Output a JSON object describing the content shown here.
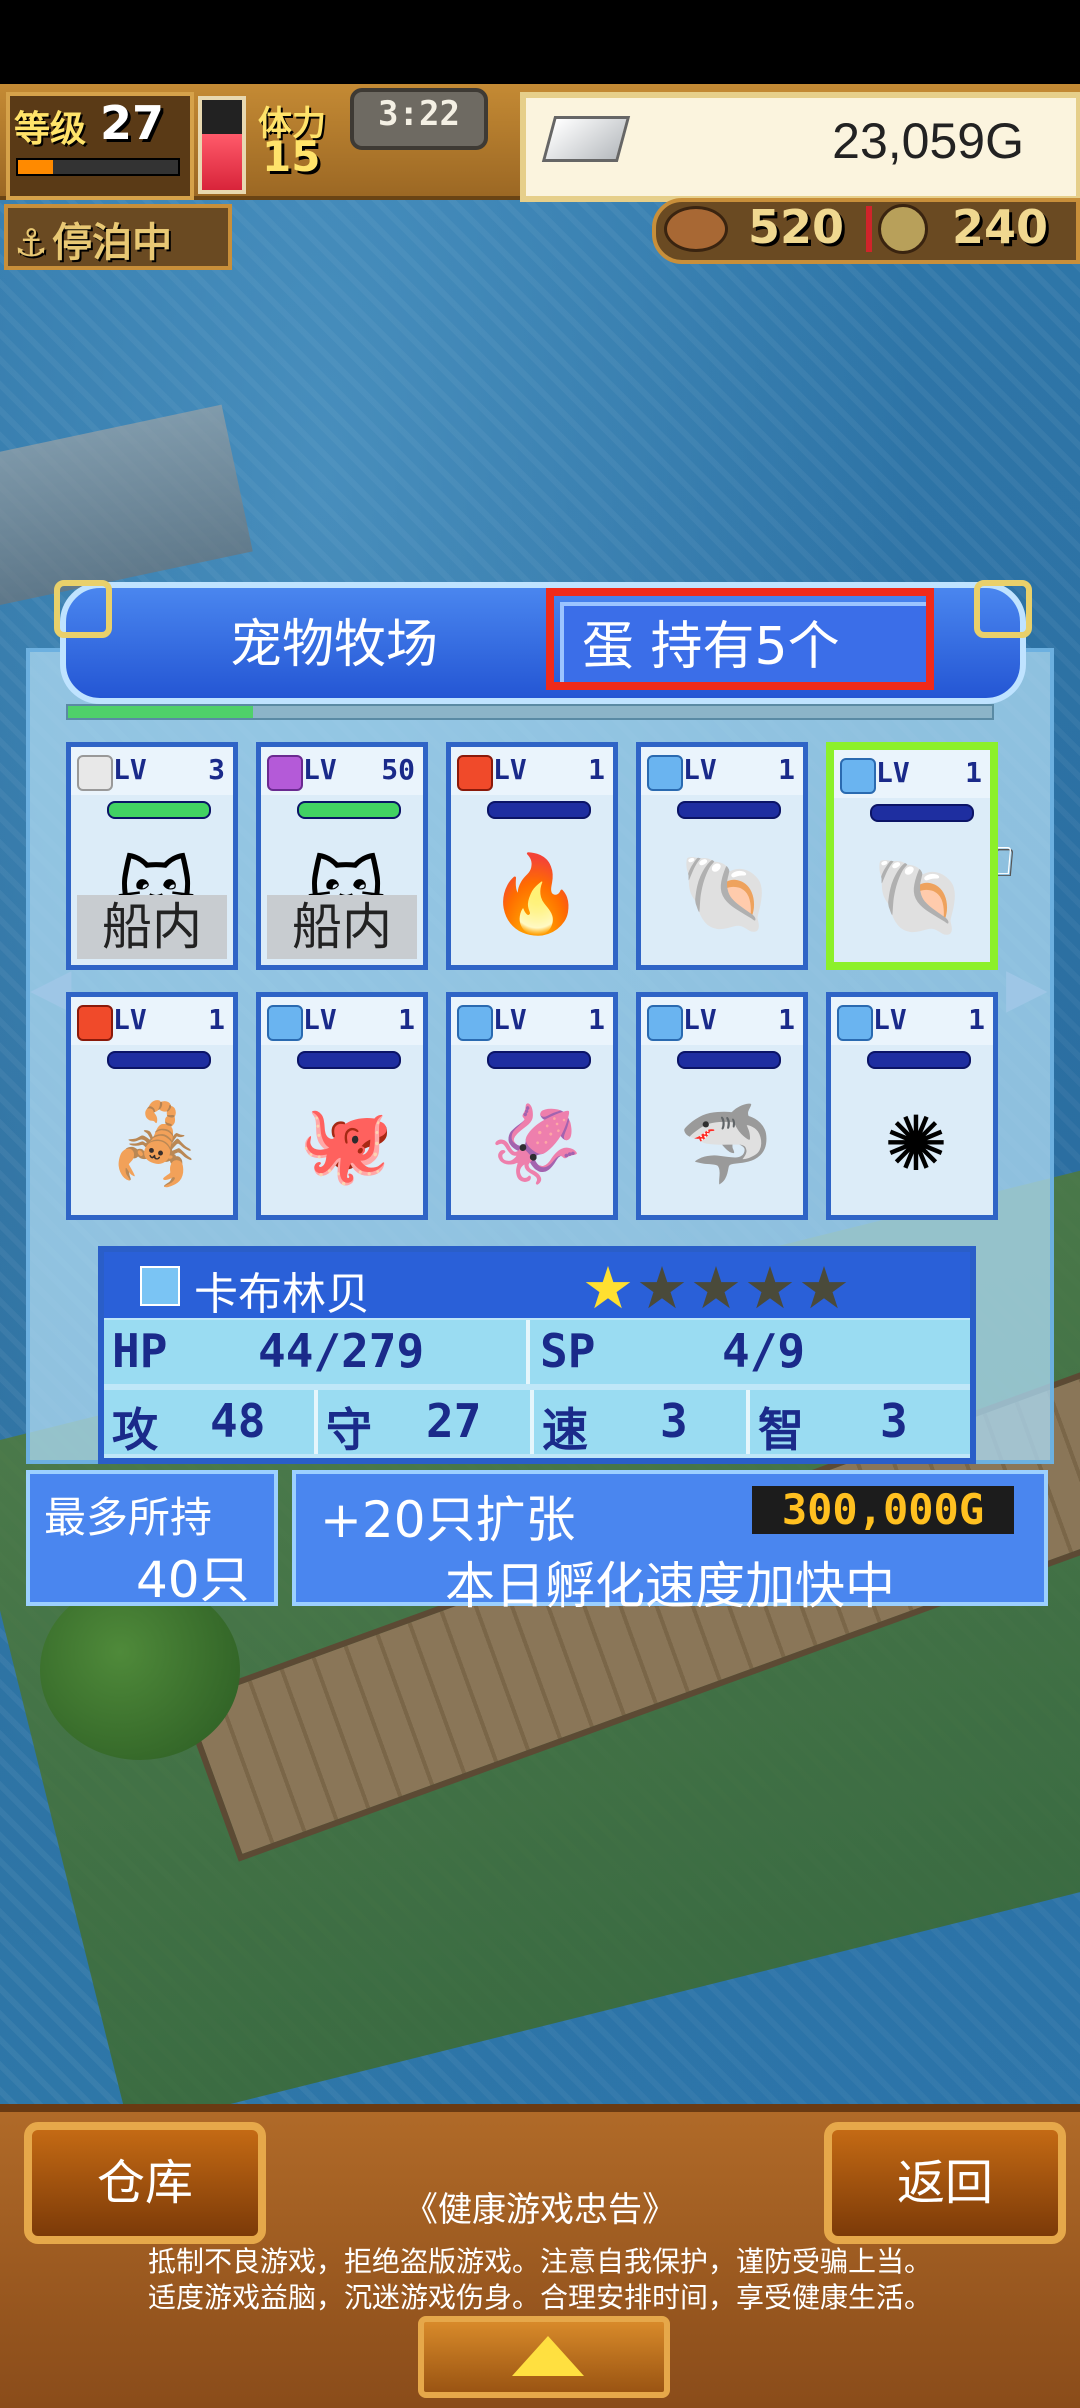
{
  "hud": {
    "level_label": "等级",
    "level_value": "27",
    "stamina_label": "体力",
    "stamina_value": "15",
    "timer": "3:22",
    "gold": "23,059G",
    "status": "停泊中",
    "res1": "520",
    "res2": "240"
  },
  "panel": {
    "title": "宠物牧场",
    "eggs": "蛋 持有5个",
    "progress_fraction": 0.2
  },
  "pets": [
    {
      "element": "white",
      "lv_label": "LV",
      "level": "3",
      "icon": "cat-icon",
      "glyph": "🐱",
      "place": "船内",
      "hp_green": true
    },
    {
      "element": "purple",
      "lv_label": "LV",
      "level": "50",
      "icon": "cat-icon",
      "glyph": "🐱",
      "place": "船内",
      "hp_green": true
    },
    {
      "element": "fire",
      "lv_label": "LV",
      "level": "1",
      "icon": "flame-monster-icon",
      "glyph": "🔥"
    },
    {
      "element": "water",
      "lv_label": "LV",
      "level": "1",
      "icon": "hermit-crab-icon",
      "glyph": "🐚"
    },
    {
      "element": "water",
      "lv_label": "LV",
      "level": "1",
      "icon": "cone-shell-icon",
      "glyph": "🐚",
      "selected": true
    },
    {
      "element": "fire",
      "lv_label": "LV",
      "level": "1",
      "icon": "scorpion-icon",
      "glyph": "🦂"
    },
    {
      "element": "water",
      "lv_label": "LV",
      "level": "1",
      "icon": "octopus-icon",
      "glyph": "🐙"
    },
    {
      "element": "water",
      "lv_label": "LV",
      "level": "1",
      "icon": "squid-icon",
      "glyph": "🦑"
    },
    {
      "element": "water",
      "lv_label": "LV",
      "level": "1",
      "icon": "shark-icon",
      "glyph": "🦈"
    },
    {
      "element": "water",
      "lv_label": "LV",
      "level": "1",
      "icon": "urchin-icon",
      "glyph": "✺"
    }
  ],
  "detail": {
    "name": "卡布林贝",
    "stars_filled": 1,
    "stars_total": 5,
    "hp_label": "HP",
    "hp": "44/279",
    "sp_label": "SP",
    "sp": "4/9",
    "atk_label": "攻",
    "atk": "48",
    "def_label": "守",
    "def": "27",
    "spd_label": "速",
    "spd": "3",
    "int_label": "智",
    "int": "3"
  },
  "capacity": {
    "label": "最多所持",
    "value": "40只",
    "expand": "+20只扩张",
    "price": "300,000G",
    "hatch_note": "本日孵化速度加快中"
  },
  "bottom": {
    "warehouse": "仓库",
    "back": "返回",
    "notice_title": "《健康游戏忠告》",
    "notice_line1": "抵制不良游戏，拒绝盗版游戏。注意自我保护，谨防受骗上当。",
    "notice_line2": "适度游戏益脑，沉迷游戏伤身。合理安排时间，享受健康生活。"
  }
}
